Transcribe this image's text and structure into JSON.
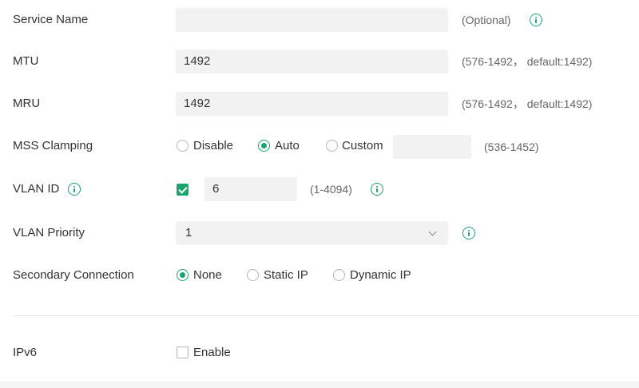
{
  "service_name": {
    "label": "Service Name",
    "value": "",
    "hint": "(Optional)"
  },
  "mtu": {
    "label": "MTU",
    "value": "1492",
    "hint": "(576-1492， default:1492)"
  },
  "mru": {
    "label": "MRU",
    "value": "1492",
    "hint": "(576-1492， default:1492)"
  },
  "mss_clamping": {
    "label": "MSS Clamping",
    "options": [
      "Disable",
      "Auto",
      "Custom"
    ],
    "selected": "Auto",
    "custom_value": "",
    "hint": "(536-1452)"
  },
  "vlan_id": {
    "label": "VLAN ID",
    "checked": true,
    "value": "6",
    "hint": "(1-4094)"
  },
  "vlan_priority": {
    "label": "VLAN Priority",
    "value": "1"
  },
  "secondary_connection": {
    "label": "Secondary Connection",
    "options": [
      "None",
      "Static IP",
      "Dynamic IP"
    ],
    "selected": "None"
  },
  "ipv6": {
    "label": "IPv6",
    "enable_label": "Enable",
    "checked": false
  },
  "colors": {
    "accent": "#1aa36c",
    "input_bg": "#f2f2f2",
    "text": "#333333",
    "hint": "#666666"
  }
}
